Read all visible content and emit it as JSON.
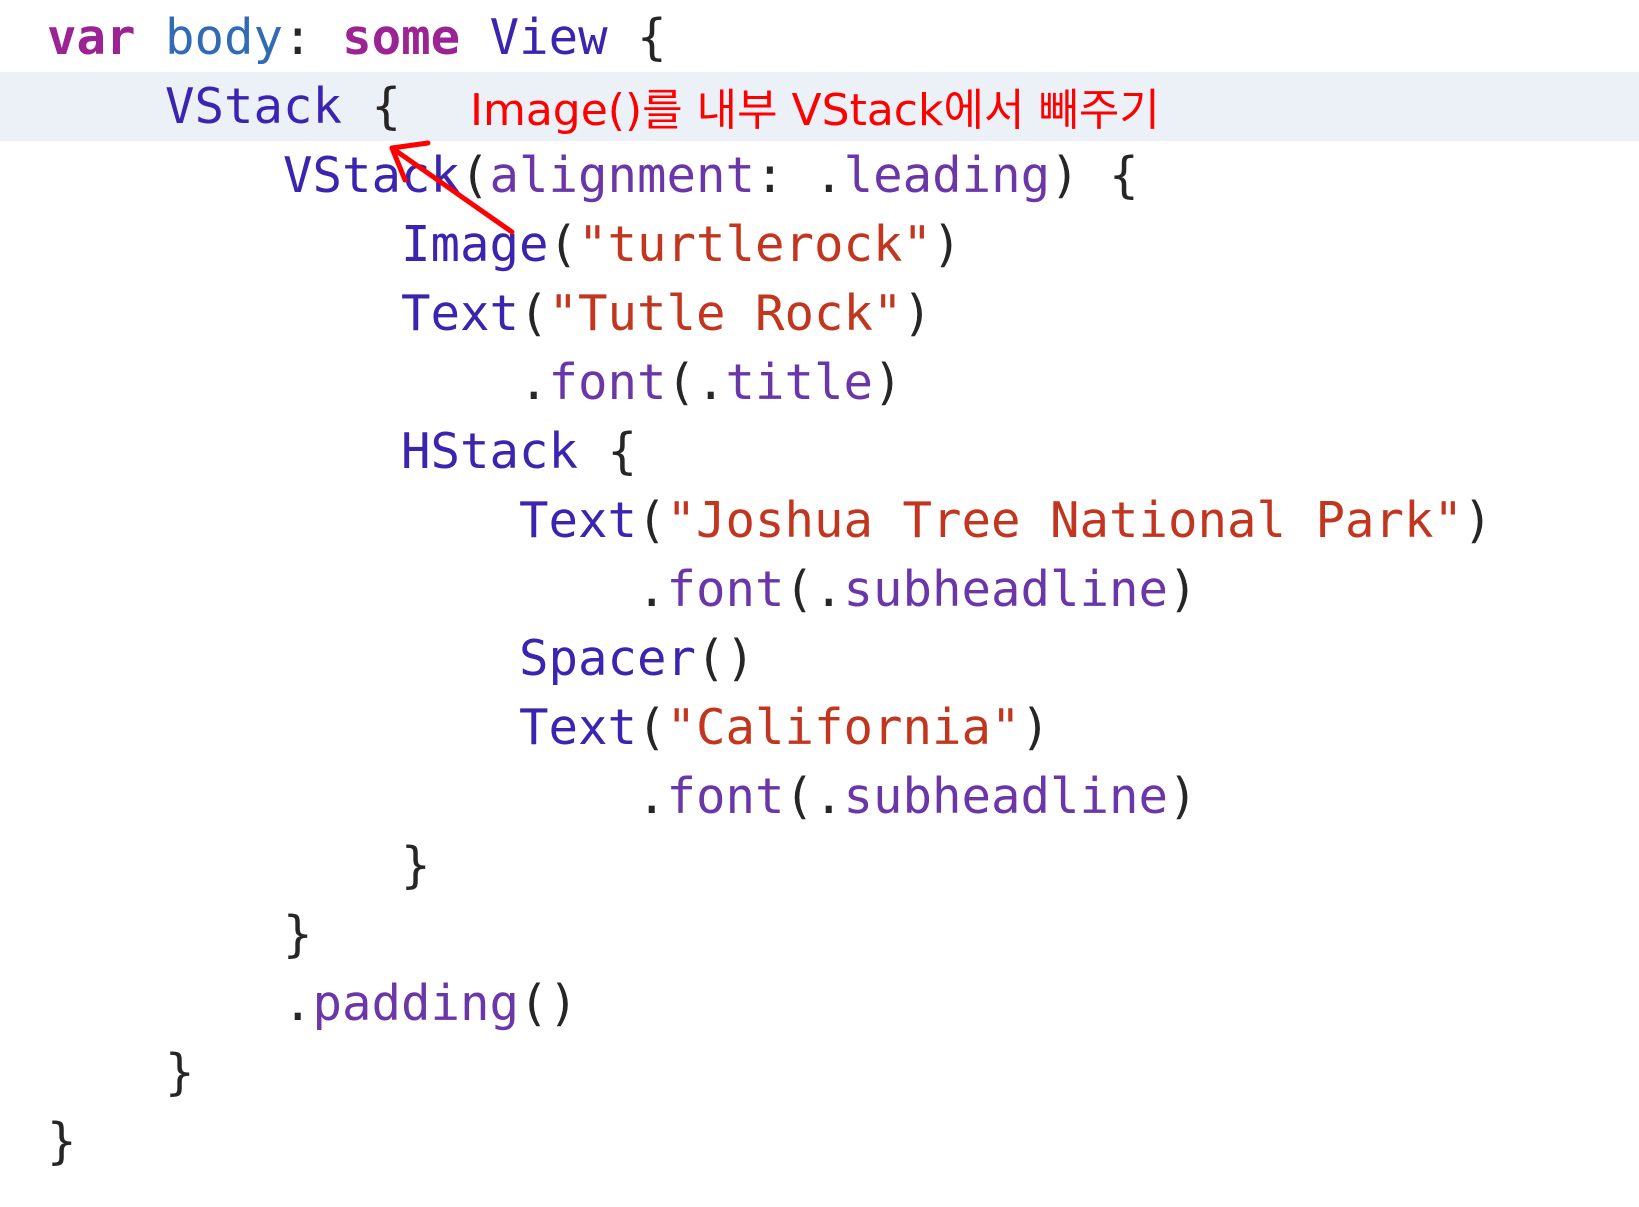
{
  "code_lines": [
    [
      {
        "t": "var",
        "k": "kw"
      },
      {
        "t": " "
      },
      {
        "t": "body",
        "k": "id"
      },
      {
        "t": ": "
      },
      {
        "t": "some",
        "k": "kw"
      },
      {
        "t": " "
      },
      {
        "t": "View",
        "k": "type"
      },
      {
        "t": " {"
      }
    ],
    [
      {
        "t": "    "
      },
      {
        "t": "VStack",
        "k": "type"
      },
      {
        "t": " {"
      }
    ],
    [
      {
        "t": "        "
      },
      {
        "t": "VStack",
        "k": "type"
      },
      {
        "t": "("
      },
      {
        "t": "alignment",
        "k": "prop"
      },
      {
        "t": ": ."
      },
      {
        "t": "leading",
        "k": "prop"
      },
      {
        "t": ") {"
      }
    ],
    [
      {
        "t": "            "
      },
      {
        "t": "Image",
        "k": "type"
      },
      {
        "t": "("
      },
      {
        "t": "\"turtlerock\"",
        "k": "str"
      },
      {
        "t": ")"
      }
    ],
    [
      {
        "t": "            "
      },
      {
        "t": "Text",
        "k": "type"
      },
      {
        "t": "("
      },
      {
        "t": "\"Tutle Rock\"",
        "k": "str"
      },
      {
        "t": ")"
      }
    ],
    [
      {
        "t": "                ."
      },
      {
        "t": "font",
        "k": "prop"
      },
      {
        "t": "(."
      },
      {
        "t": "title",
        "k": "prop"
      },
      {
        "t": ")"
      }
    ],
    [
      {
        "t": "            "
      },
      {
        "t": "HStack",
        "k": "type"
      },
      {
        "t": " {"
      }
    ],
    [
      {
        "t": "                "
      },
      {
        "t": "Text",
        "k": "type"
      },
      {
        "t": "("
      },
      {
        "t": "\"Joshua Tree National Park\"",
        "k": "str"
      },
      {
        "t": ")"
      }
    ],
    [
      {
        "t": "                    ."
      },
      {
        "t": "font",
        "k": "prop"
      },
      {
        "t": "(."
      },
      {
        "t": "subheadline",
        "k": "prop"
      },
      {
        "t": ")"
      }
    ],
    [
      {
        "t": "                "
      },
      {
        "t": "Spacer",
        "k": "type"
      },
      {
        "t": "()"
      }
    ],
    [
      {
        "t": "                "
      },
      {
        "t": "Text",
        "k": "type"
      },
      {
        "t": "("
      },
      {
        "t": "\"California\"",
        "k": "str"
      },
      {
        "t": ")"
      }
    ],
    [
      {
        "t": "                    ."
      },
      {
        "t": "font",
        "k": "prop"
      },
      {
        "t": "(."
      },
      {
        "t": "subheadline",
        "k": "prop"
      },
      {
        "t": ")"
      }
    ],
    [
      {
        "t": "            }"
      }
    ],
    [
      {
        "t": "        }"
      }
    ],
    [
      {
        "t": "        ."
      },
      {
        "t": "padding",
        "k": "prop"
      },
      {
        "t": "()"
      }
    ],
    [
      {
        "t": "    }"
      }
    ],
    [
      {
        "t": "}"
      }
    ]
  ],
  "highlighted_line": 1,
  "annotation": {
    "text": "Image()를 내부 VStack에서 빼주기",
    "color": "#ff0000"
  },
  "colors": {
    "keyword": "#9b2393",
    "identifier": "#316bb5",
    "type": "#3a24b0",
    "string": "#c2361f",
    "property": "#6b36a8",
    "plain": "#262626",
    "line_highlight": "#ecf1f8"
  }
}
